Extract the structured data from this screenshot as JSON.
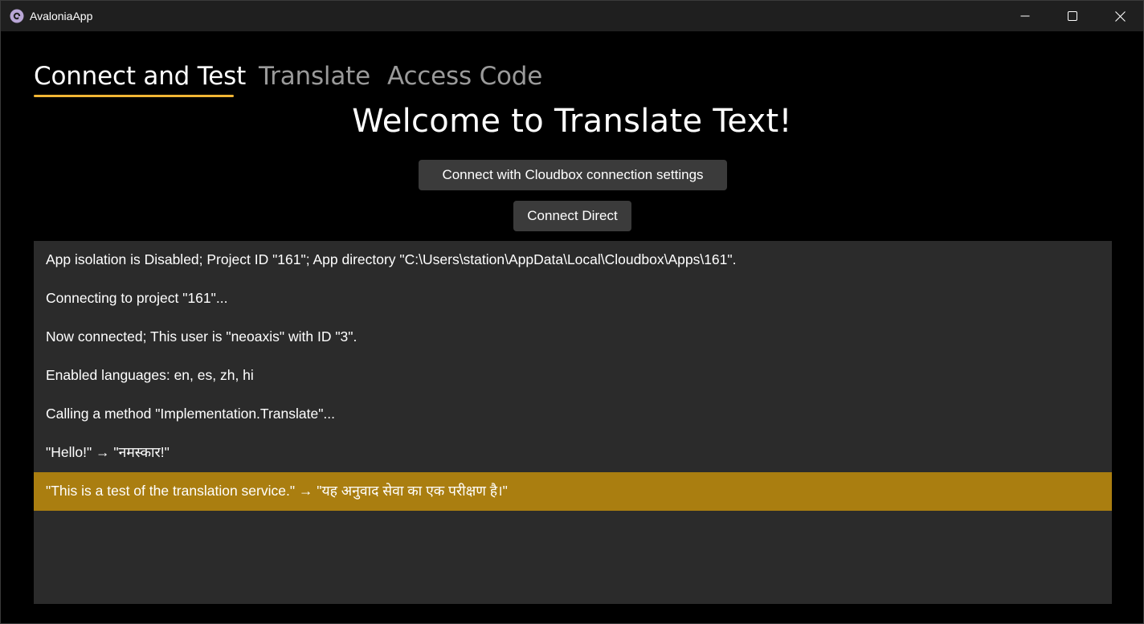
{
  "window": {
    "title": "AvaloniaApp",
    "icon": "avalonia-logo-icon",
    "controls": [
      "minimize-icon",
      "maximize-icon",
      "close-icon"
    ]
  },
  "tabs": [
    {
      "label": "Connect and Test",
      "selected": true
    },
    {
      "label": "Translate",
      "selected": false
    },
    {
      "label": "Access Code",
      "selected": false
    }
  ],
  "main": {
    "heading": "Welcome to Translate Text!",
    "connect_cloudbox_label": "Connect with Cloudbox connection settings",
    "connect_direct_label": "Connect Direct"
  },
  "log": {
    "items": [
      "App isolation is Disabled; Project ID \"161\"; App directory \"C:\\Users\\station\\AppData\\Local\\Cloudbox\\Apps\\161\".",
      "Connecting to project \"161\"...",
      "Now connected; This user is \"neoaxis\" with ID \"3\".",
      "Enabled languages: en, es, zh, hi",
      "Calling a method \"Implementation.Translate\"...",
      "\"Hello!\" → \"नमस्कार!\"",
      "\"This is a test of the translation service.\" → \"यह अनुवाद सेवा का एक परीक्षण है।\""
    ],
    "selected_index": 6
  },
  "colors": {
    "accent": "#f2b534",
    "selection": "#aa7e10",
    "panel": "#2b2b2b",
    "button": "#3b3b3b",
    "background": "#000000"
  }
}
